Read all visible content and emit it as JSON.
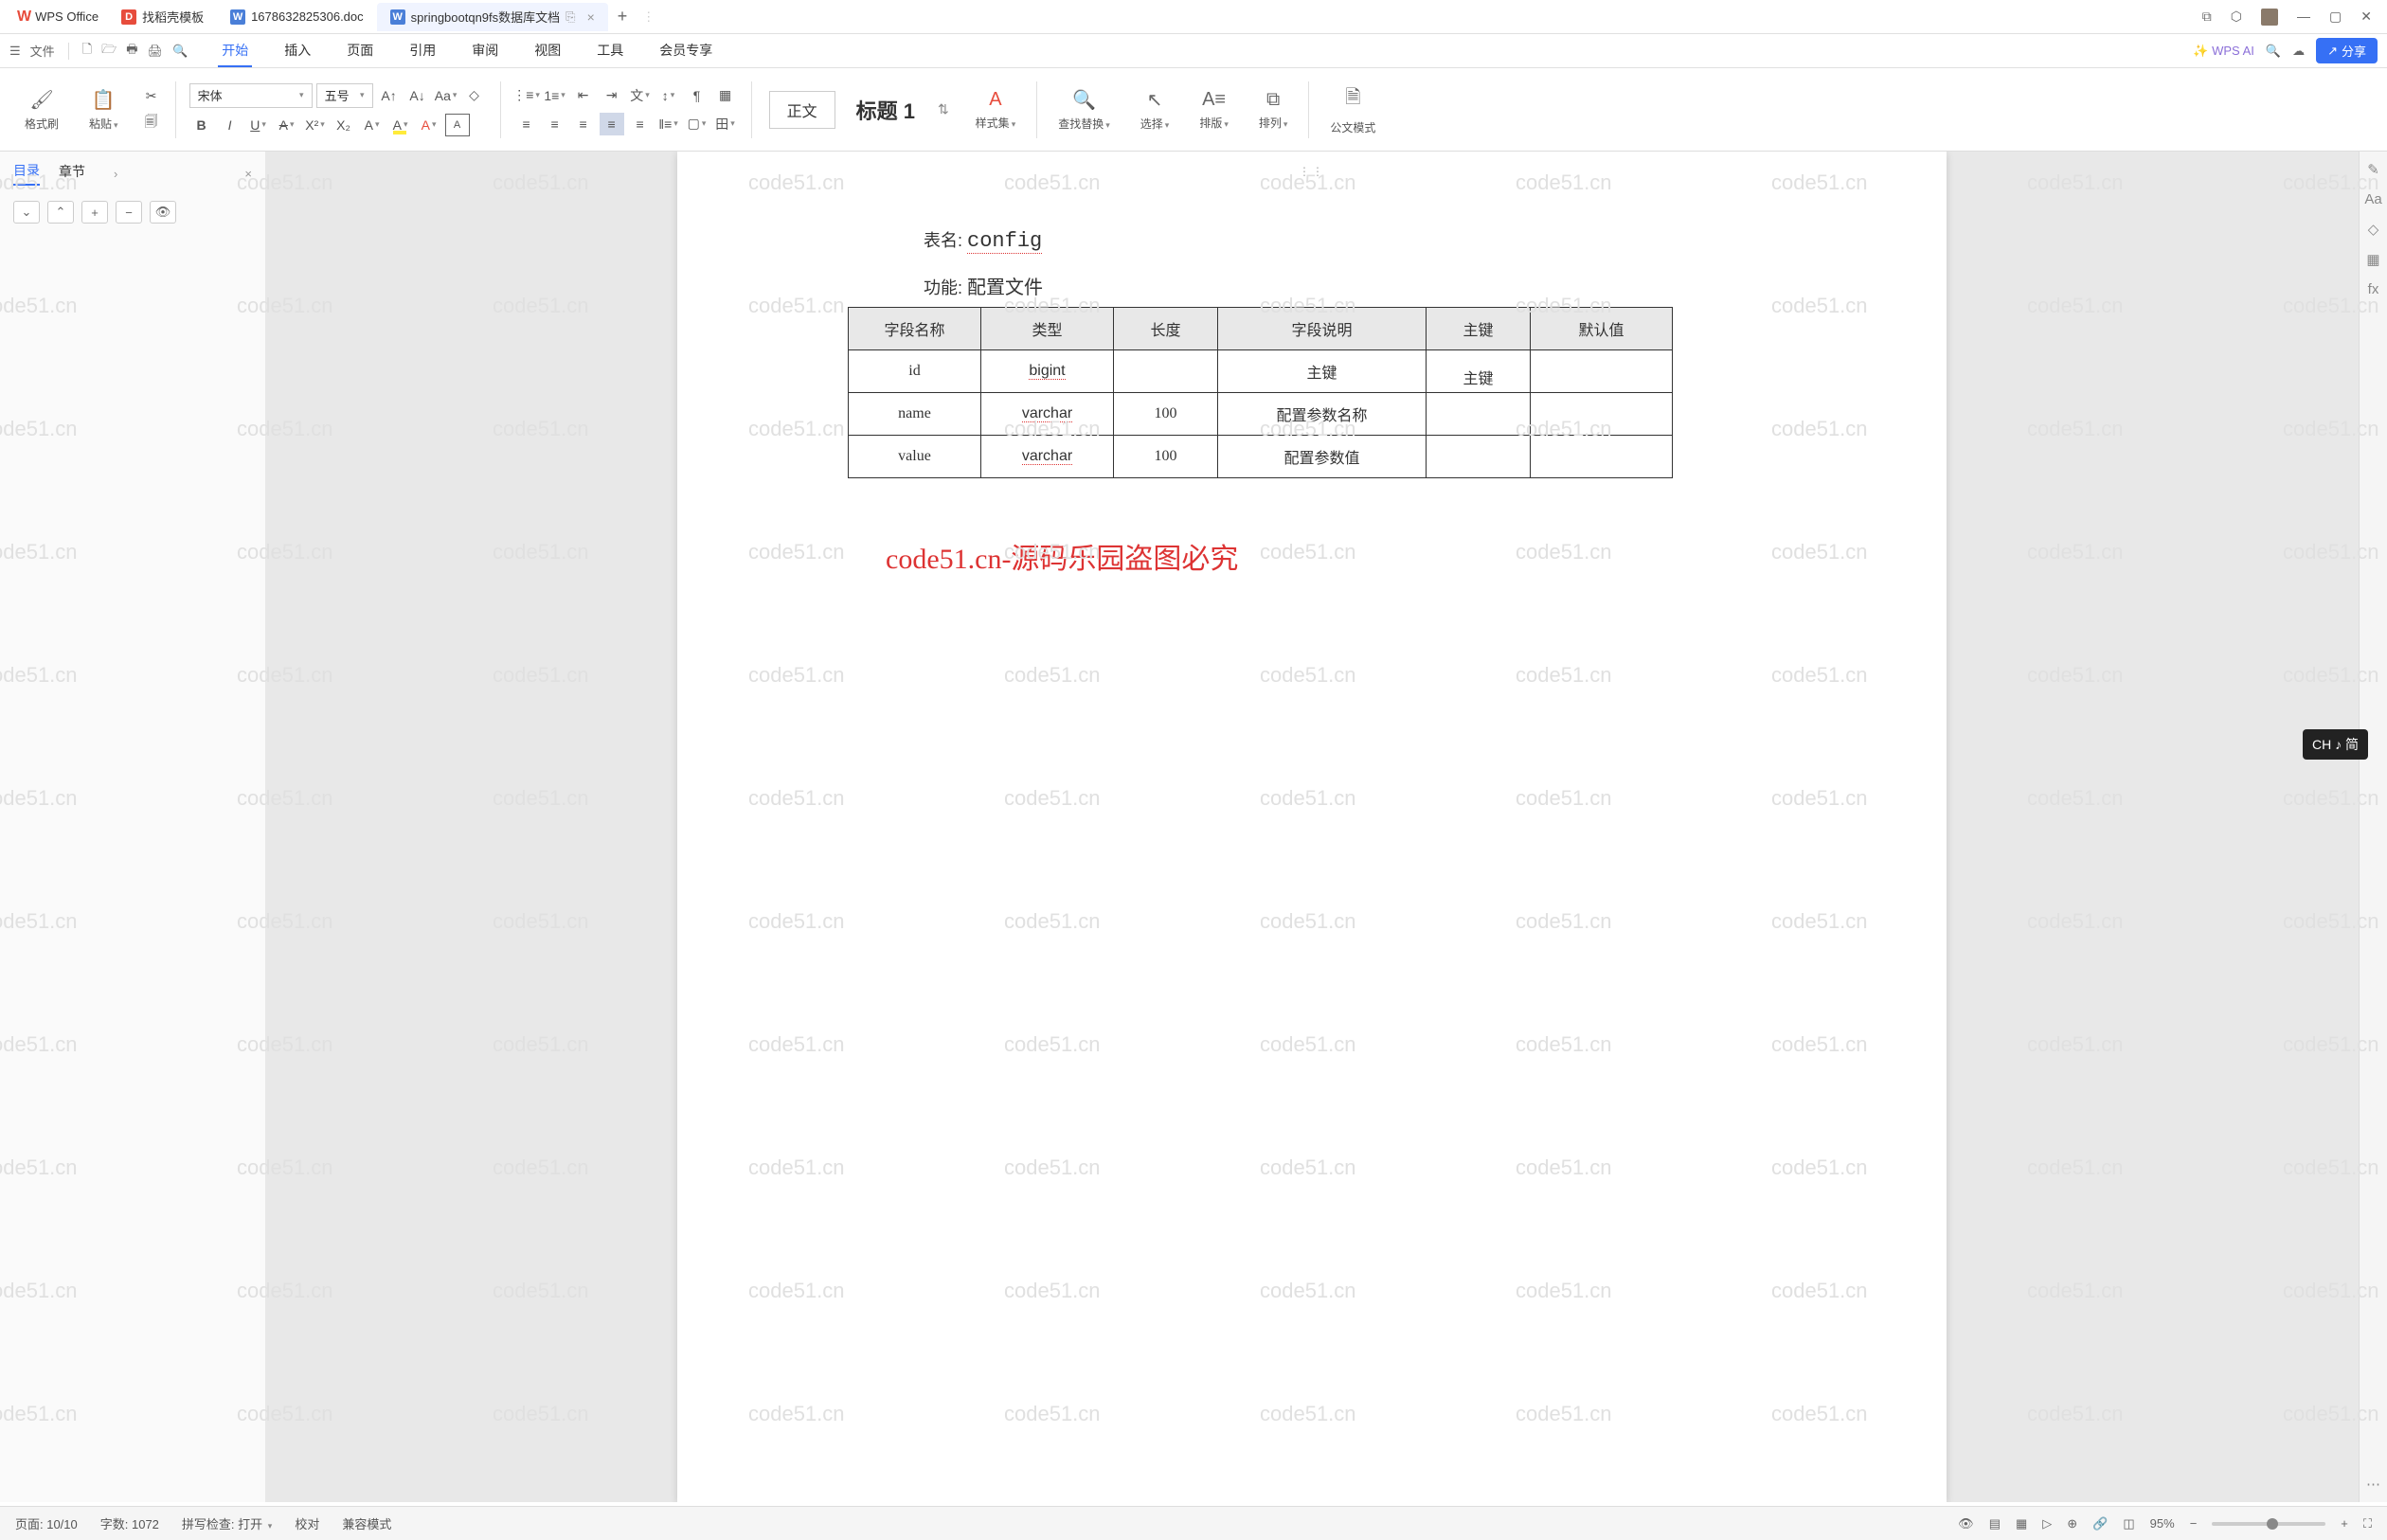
{
  "app": {
    "name": "WPS Office"
  },
  "tabs": [
    {
      "label": "找稻壳模板",
      "icon": "D",
      "color": "red"
    },
    {
      "label": "1678632825306.doc",
      "icon": "W",
      "color": "blue"
    },
    {
      "label": "springbootqn9fs数据库文档",
      "icon": "W",
      "color": "blue",
      "active": true
    }
  ],
  "menu": {
    "file": "文件",
    "tabs": [
      "开始",
      "插入",
      "页面",
      "引用",
      "审阅",
      "视图",
      "工具",
      "会员专享"
    ],
    "active": "开始",
    "wps_ai": "WPS AI",
    "share": "分享"
  },
  "ribbon": {
    "format_brush": "格式刷",
    "paste": "粘贴",
    "font_name": "宋体",
    "font_size": "五号",
    "body_text": "正文",
    "heading1": "标题 1",
    "styles": "样式集",
    "find_replace": "查找替换",
    "select": "选择",
    "layout": "排版",
    "arrange": "排列",
    "official": "公文模式"
  },
  "side": {
    "toc": "目录",
    "chapter": "章节"
  },
  "doc": {
    "table_name_label": "表名:",
    "table_name": "config",
    "function_label": "功能:",
    "function": "配置文件",
    "headers": [
      "字段名称",
      "类型",
      "长度",
      "字段说明",
      "主键",
      "默认值"
    ],
    "rows": [
      {
        "name": "id",
        "type": "bigint",
        "len": "",
        "desc": "主键",
        "pk": "主键",
        "def": ""
      },
      {
        "name": "name",
        "type": "varchar",
        "len": "100",
        "desc": "配置参数名称",
        "pk": "",
        "def": ""
      },
      {
        "name": "value",
        "type": "varchar",
        "len": "100",
        "desc": "配置参数值",
        "pk": "",
        "def": ""
      }
    ],
    "watermark_red": "code51.cn-源码乐园盗图必究",
    "watermark_bg": "code51.cn"
  },
  "status": {
    "page": "页面: 10/10",
    "words": "字数: 1072",
    "spell": "拼写检查: 打开",
    "proof": "校对",
    "compat": "兼容模式",
    "zoom": "95%"
  },
  "ime": "CH ♪ 简"
}
